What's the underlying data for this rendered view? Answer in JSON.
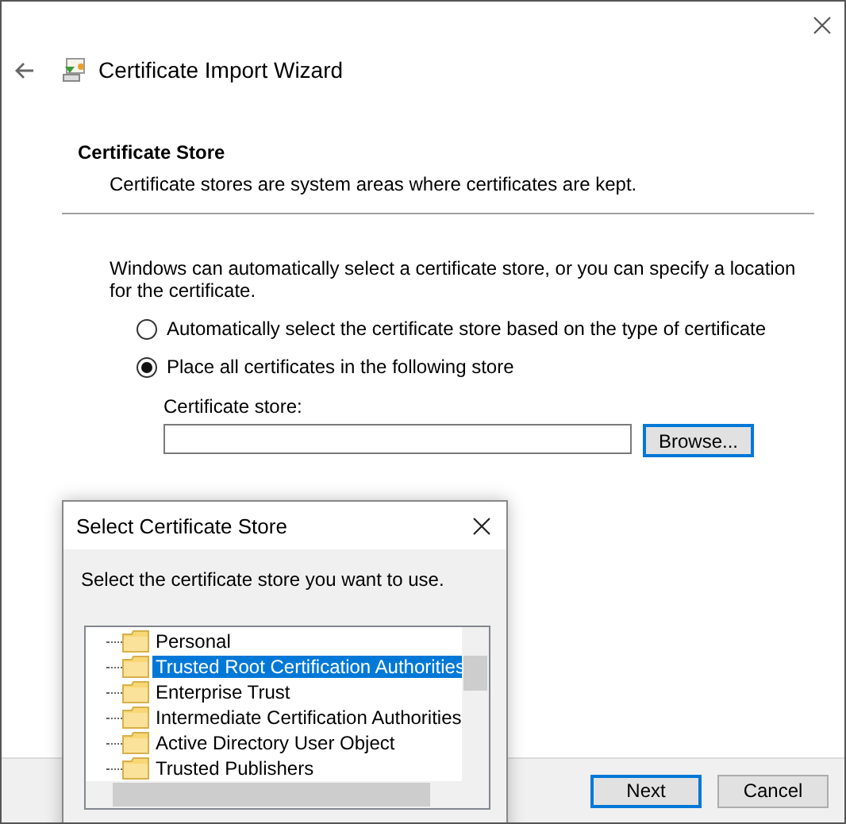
{
  "window": {
    "title": "Certificate Import Wizard"
  },
  "section": {
    "heading": "Certificate Store",
    "description": "Certificate stores are system areas where certificates are kept."
  },
  "intro": "Windows can automatically select a certificate store, or you can specify a location for the certificate.",
  "options": [
    {
      "label": "Automatically select the certificate store based on the type of certificate",
      "selected": false
    },
    {
      "label": "Place all certificates in the following store",
      "selected": true
    }
  ],
  "store_field": {
    "label": "Certificate store:"
  },
  "browse_button": "Browse...",
  "buttons": [
    {
      "label": "Next",
      "default": true
    },
    {
      "label": "Cancel",
      "default": false
    }
  ],
  "dialog": {
    "title": "Select Certificate Store",
    "prompt": "Select the certificate store you want to use.",
    "stores": [
      {
        "label": "Personal",
        "selected": false
      },
      {
        "label": "Trusted Root Certification Authorities",
        "selected": true
      },
      {
        "label": "Enterprise Trust",
        "selected": false
      },
      {
        "label": "Intermediate Certification Authorities",
        "selected": false
      },
      {
        "label": "Active Directory User Object",
        "selected": false
      },
      {
        "label": "Trusted Publishers",
        "selected": false
      }
    ]
  }
}
